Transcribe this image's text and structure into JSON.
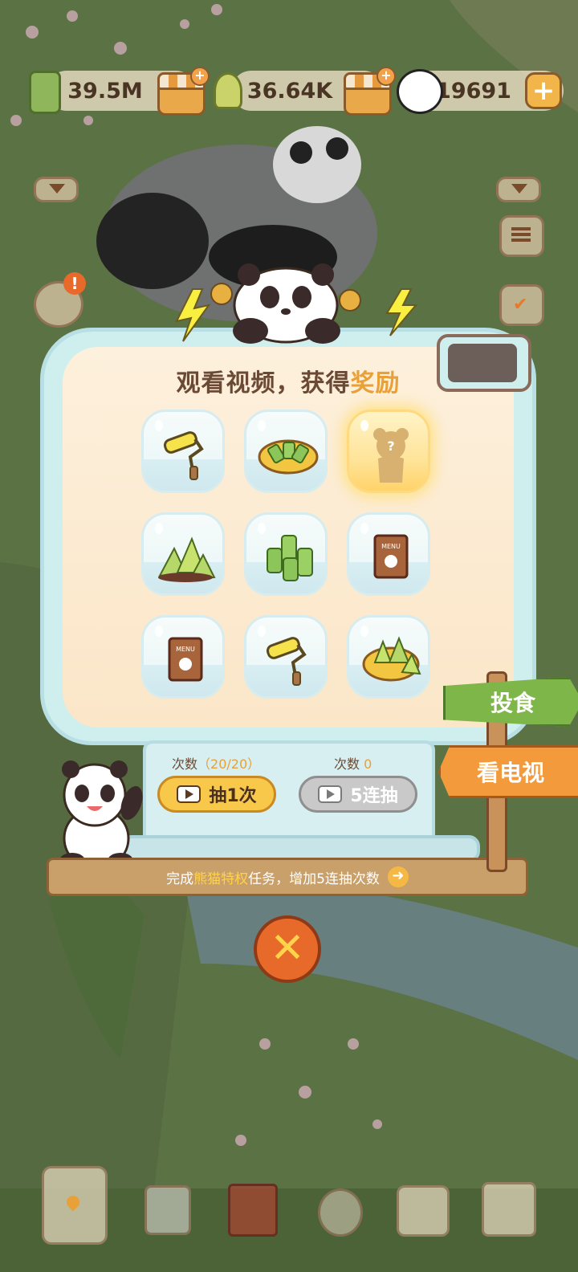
{
  "resources": {
    "bamboo_amount": "39.5M",
    "shoot_amount": "36.64K",
    "panda_coins": "19691"
  },
  "icons": {
    "bamboo": "bamboo-icon",
    "shop": "shop-icon",
    "shoot": "bamboo-shoot-icon",
    "panda": "panda-icon",
    "plus": "plus-icon",
    "close": "close-icon"
  },
  "dialog": {
    "title_prefix": "观看视频，获得",
    "title_highlight": "奖励",
    "rewards": [
      {
        "icon": "paint-roller-icon"
      },
      {
        "icon": "bamboo-bowl-icon"
      },
      {
        "icon": "mystery-bear-icon",
        "label": "?",
        "selected": true
      },
      {
        "icon": "bamboo-shoots-icon"
      },
      {
        "icon": "bamboo-stalks-icon"
      },
      {
        "icon": "menu-book-icon",
        "label": "MENU"
      },
      {
        "icon": "menu-book-icon",
        "label": "MENU"
      },
      {
        "icon": "paint-roller-icon"
      },
      {
        "icon": "shoot-basket-icon"
      }
    ],
    "count_label": "次数",
    "single_count": "（20/20）",
    "five_count": "0",
    "single_pull_label": "抽1次",
    "five_pull_label": "5连抽",
    "task_text_prefix": "完成",
    "task_text_highlight": "熊猫特权",
    "task_text_suffix": "任务，增加5连抽次数"
  },
  "signs": {
    "feed": "投食",
    "watch_tv": "看电视"
  },
  "colors": {
    "accent": "#e8a038",
    "dialog": "#cfeeee",
    "panel": "#fdf0dc"
  }
}
